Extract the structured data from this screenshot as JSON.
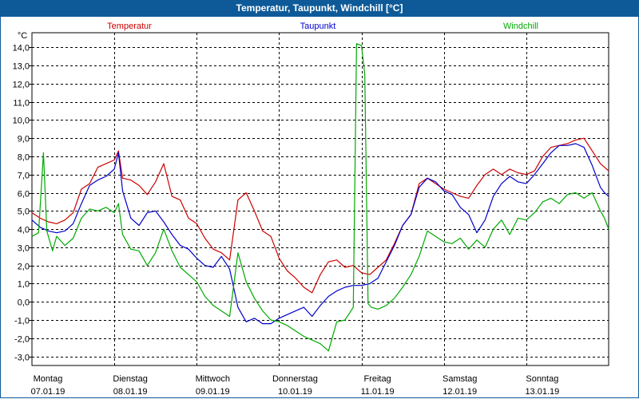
{
  "title": "Temperatur, Taupunkt, Windchill [°C]",
  "chart_data": {
    "type": "line",
    "unit_label": "°C",
    "ylim": [
      -3.5,
      14.8
    ],
    "yticks": [
      14,
      13,
      12,
      11,
      10,
      9,
      8,
      7,
      6,
      5,
      4,
      3,
      2,
      1,
      0,
      -1,
      -2,
      -3
    ],
    "ytick_labels": [
      "14,0",
      "13,0",
      "12,0",
      "11,0",
      "10,0",
      "9,0",
      "8,0",
      "7,0",
      "6,0",
      "5,0",
      "4,0",
      "3,0",
      "2,0",
      "1,0",
      "0,0",
      "-1,0",
      "-2,0",
      "-3,0"
    ],
    "xlim": [
      0,
      7
    ],
    "day_labels": [
      {
        "day": "Montag",
        "date": "07.01.19"
      },
      {
        "day": "Dienstag",
        "date": "08.01.19"
      },
      {
        "day": "Mittwoch",
        "date": "09.01.19"
      },
      {
        "day": "Donnerstag",
        "date": "10.01.19"
      },
      {
        "day": "Freitag",
        "date": "11.01.19"
      },
      {
        "day": "Samstag",
        "date": "12.01.19"
      },
      {
        "day": "Sonntag",
        "date": "13.01.19"
      }
    ],
    "grid": true,
    "series": [
      {
        "name": "Temperatur",
        "color": "#cc0000",
        "x": [
          0,
          0.1,
          0.2,
          0.3,
          0.4,
          0.5,
          0.6,
          0.7,
          0.8,
          0.9,
          1.0,
          1.05,
          1.1,
          1.2,
          1.3,
          1.4,
          1.5,
          1.6,
          1.7,
          1.8,
          1.9,
          2.0,
          2.1,
          2.2,
          2.3,
          2.4,
          2.5,
          2.6,
          2.7,
          2.8,
          2.9,
          3.0,
          3.1,
          3.2,
          3.3,
          3.4,
          3.5,
          3.6,
          3.7,
          3.8,
          3.9,
          4.0,
          4.1,
          4.2,
          4.3,
          4.4,
          4.5,
          4.6,
          4.7,
          4.8,
          4.9,
          5.0,
          5.1,
          5.2,
          5.3,
          5.4,
          5.5,
          5.6,
          5.7,
          5.8,
          5.9,
          6.0,
          6.1,
          6.2,
          6.3,
          6.4,
          6.5,
          6.6,
          6.7,
          6.8,
          6.9,
          6.95,
          7.0
        ],
        "y": [
          4.9,
          4.6,
          4.4,
          4.3,
          4.5,
          4.9,
          6.2,
          6.5,
          7.4,
          7.6,
          7.8,
          8.3,
          6.8,
          6.7,
          6.4,
          5.9,
          6.6,
          7.6,
          5.8,
          5.6,
          4.6,
          4.3,
          3.5,
          2.9,
          2.7,
          2.3,
          5.6,
          6.0,
          5.0,
          3.9,
          3.6,
          2.4,
          1.7,
          1.3,
          0.8,
          0.5,
          1.5,
          2.2,
          2.3,
          1.9,
          2.0,
          1.6,
          1.5,
          1.9,
          2.3,
          3.2,
          4.2,
          4.8,
          6.5,
          6.8,
          6.5,
          6.2,
          6.0,
          5.8,
          5.7,
          6.4,
          7.0,
          7.3,
          7.0,
          7.3,
          7.1,
          7.0,
          7.2,
          8.0,
          8.5,
          8.6,
          8.7,
          8.9,
          9.0,
          8.3,
          7.6,
          7.4,
          7.2
        ]
      },
      {
        "name": "Taupunkt",
        "color": "#0000cc",
        "x": [
          0,
          0.1,
          0.2,
          0.3,
          0.4,
          0.5,
          0.6,
          0.7,
          0.8,
          0.9,
          1.0,
          1.05,
          1.1,
          1.2,
          1.3,
          1.4,
          1.5,
          1.6,
          1.7,
          1.8,
          1.9,
          2.0,
          2.1,
          2.2,
          2.3,
          2.4,
          2.5,
          2.6,
          2.7,
          2.8,
          2.9,
          3.0,
          3.1,
          3.2,
          3.3,
          3.4,
          3.5,
          3.6,
          3.7,
          3.8,
          3.9,
          4.0,
          4.1,
          4.2,
          4.3,
          4.4,
          4.5,
          4.6,
          4.7,
          4.8,
          4.9,
          5.0,
          5.1,
          5.2,
          5.3,
          5.4,
          5.5,
          5.6,
          5.7,
          5.8,
          5.9,
          6.0,
          6.1,
          6.2,
          6.3,
          6.4,
          6.5,
          6.6,
          6.7,
          6.8,
          6.9,
          6.95,
          7.0
        ],
        "y": [
          4.5,
          4.1,
          3.9,
          3.8,
          3.9,
          4.3,
          5.4,
          6.4,
          6.7,
          6.9,
          7.3,
          8.2,
          6.1,
          4.6,
          4.2,
          4.9,
          5.0,
          4.4,
          3.7,
          3.1,
          2.9,
          2.4,
          2.0,
          1.9,
          2.5,
          1.8,
          -0.3,
          -1.1,
          -0.9,
          -1.2,
          -1.2,
          -0.9,
          -0.7,
          -0.5,
          -0.3,
          -0.8,
          -0.2,
          0.3,
          0.6,
          0.8,
          0.9,
          0.9,
          1.0,
          1.3,
          2.2,
          3.1,
          4.2,
          4.8,
          6.3,
          6.8,
          6.6,
          6.1,
          5.9,
          5.2,
          4.8,
          3.8,
          4.5,
          5.8,
          6.5,
          6.9,
          6.6,
          6.5,
          7.0,
          7.6,
          8.2,
          8.6,
          8.6,
          8.7,
          8.5,
          7.5,
          6.3,
          6.0,
          5.8
        ]
      },
      {
        "name": "Windchill",
        "color": "#00aa00",
        "x": [
          0,
          0.08,
          0.14,
          0.18,
          0.25,
          0.3,
          0.4,
          0.5,
          0.6,
          0.7,
          0.8,
          0.9,
          1.0,
          1.05,
          1.1,
          1.2,
          1.3,
          1.4,
          1.5,
          1.6,
          1.7,
          1.8,
          1.9,
          2.0,
          2.1,
          2.2,
          2.3,
          2.4,
          2.5,
          2.6,
          2.7,
          2.8,
          2.9,
          3.0,
          3.1,
          3.2,
          3.3,
          3.4,
          3.5,
          3.6,
          3.7,
          3.8,
          3.9,
          3.94,
          4.0,
          4.04,
          4.08,
          4.12,
          4.2,
          4.3,
          4.4,
          4.5,
          4.6,
          4.7,
          4.8,
          4.9,
          5.0,
          5.1,
          5.2,
          5.3,
          5.4,
          5.5,
          5.6,
          5.7,
          5.8,
          5.9,
          6.0,
          6.1,
          6.2,
          6.3,
          6.4,
          6.5,
          6.6,
          6.7,
          6.8,
          6.9,
          6.95,
          7.0
        ],
        "y": [
          3.6,
          3.8,
          8.2,
          3.9,
          2.8,
          3.6,
          3.1,
          3.5,
          4.6,
          5.1,
          5.0,
          5.2,
          4.9,
          5.4,
          3.7,
          2.9,
          2.8,
          2.0,
          2.7,
          4.0,
          2.8,
          1.9,
          1.5,
          1.1,
          0.3,
          -0.2,
          -0.5,
          -0.8,
          2.7,
          1.1,
          0.2,
          -0.5,
          -1.0,
          -1.1,
          -1.3,
          -1.6,
          -1.9,
          -2.1,
          -2.3,
          -2.7,
          -1.1,
          -1.0,
          -0.3,
          14.2,
          14.1,
          12.5,
          -0.1,
          -0.3,
          -0.4,
          -0.2,
          0.2,
          0.8,
          1.5,
          2.5,
          3.9,
          3.6,
          3.3,
          3.2,
          3.5,
          2.9,
          3.4,
          3.0,
          4.0,
          4.5,
          3.7,
          4.6,
          4.5,
          4.9,
          5.5,
          5.7,
          5.4,
          5.9,
          6.0,
          5.7,
          6.0,
          5.0,
          4.6,
          4.0
        ]
      }
    ]
  }
}
